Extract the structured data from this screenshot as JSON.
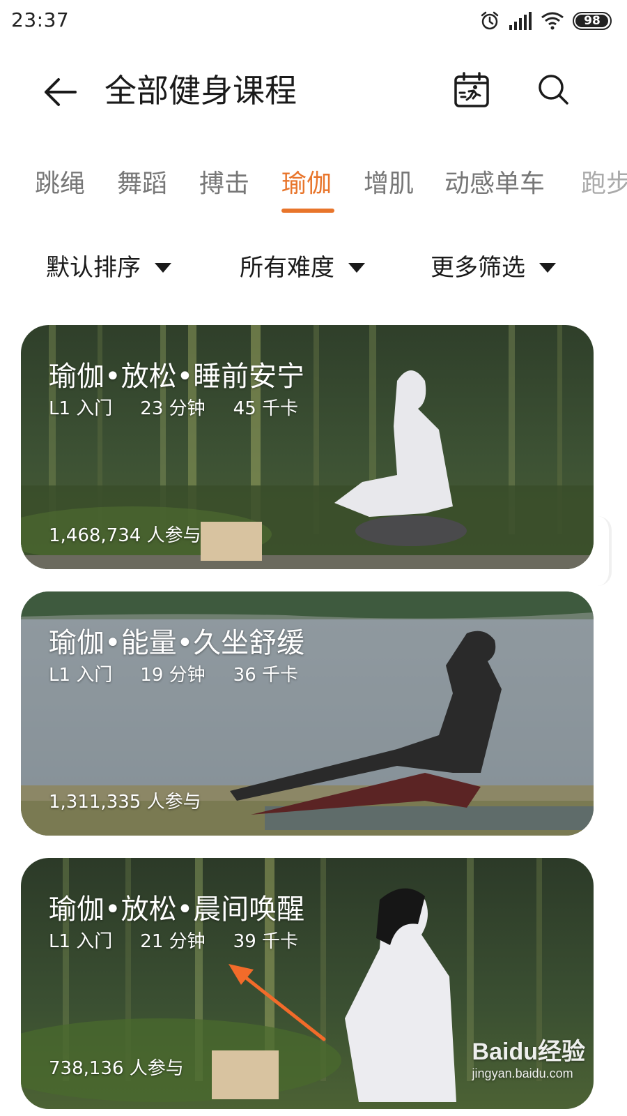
{
  "status_bar": {
    "time": "23:37",
    "battery": "98",
    "battery_level": 0.98,
    "icons": [
      "alarm-icon",
      "signal-icon",
      "wifi-icon",
      "battery-icon"
    ]
  },
  "header": {
    "title": "全部健身课程",
    "back_icon": "arrow-left-icon",
    "calendar_icon": "calendar-run-icon",
    "search_icon": "search-icon"
  },
  "tabs": {
    "items": [
      "跳绳",
      "舞蹈",
      "搏击",
      "瑜伽",
      "增肌",
      "动感单车",
      "跑步"
    ],
    "active": "瑜伽",
    "accent_color": "#e8752b"
  },
  "filters": [
    {
      "label": "默认排序"
    },
    {
      "label": "所有难度"
    },
    {
      "label": "更多筛选"
    }
  ],
  "courses": [
    {
      "title": "瑜伽•放松•睡前安宁",
      "level": "L1 入门",
      "duration": "23 分钟",
      "calories": "45 千卡",
      "participants": "1,468,734 人参与",
      "scene": "bamboo-forest"
    },
    {
      "title": "瑜伽•能量•久坐舒缓",
      "level": "L1 入门",
      "duration": "19 分钟",
      "calories": "36 千卡",
      "participants": "1,311,335 人参与",
      "scene": "lakeside"
    },
    {
      "title": "瑜伽•放松•晨间唤醒",
      "level": "L1 入门",
      "duration": "21 分钟",
      "calories": "39 千卡",
      "participants": "738,136 人参与",
      "scene": "bamboo-forest"
    }
  ],
  "watermark": {
    "logo": "Baidu经验",
    "url": "jingyan.baidu.com"
  }
}
